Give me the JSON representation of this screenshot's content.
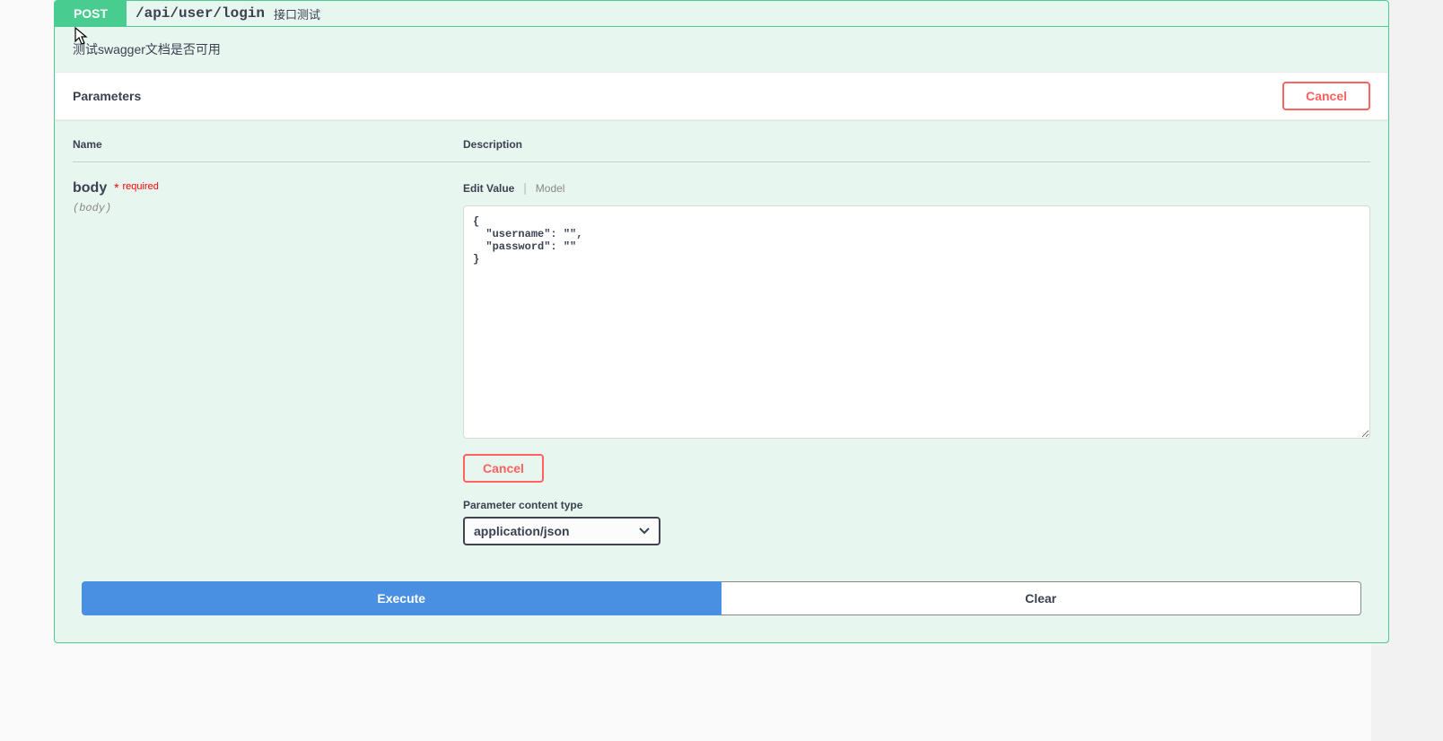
{
  "operation": {
    "method": "POST",
    "path": "/api/user/login",
    "summary": "接口测试",
    "description": "测试swagger文档是否可用"
  },
  "parameters": {
    "section_title": "Parameters",
    "cancel_label": "Cancel",
    "columns": {
      "name": "Name",
      "description": "Description"
    },
    "body_param": {
      "name": "body",
      "required_star": "*",
      "required_text": "required",
      "in": "(body)",
      "tabs": {
        "edit": "Edit Value",
        "model": "Model"
      },
      "value": "{\n  \"username\": \"\",\n  \"password\": \"\"\n}",
      "cancel_label": "Cancel",
      "content_type_label": "Parameter content type",
      "content_type_value": "application/json"
    }
  },
  "actions": {
    "execute": "Execute",
    "clear": "Clear"
  }
}
